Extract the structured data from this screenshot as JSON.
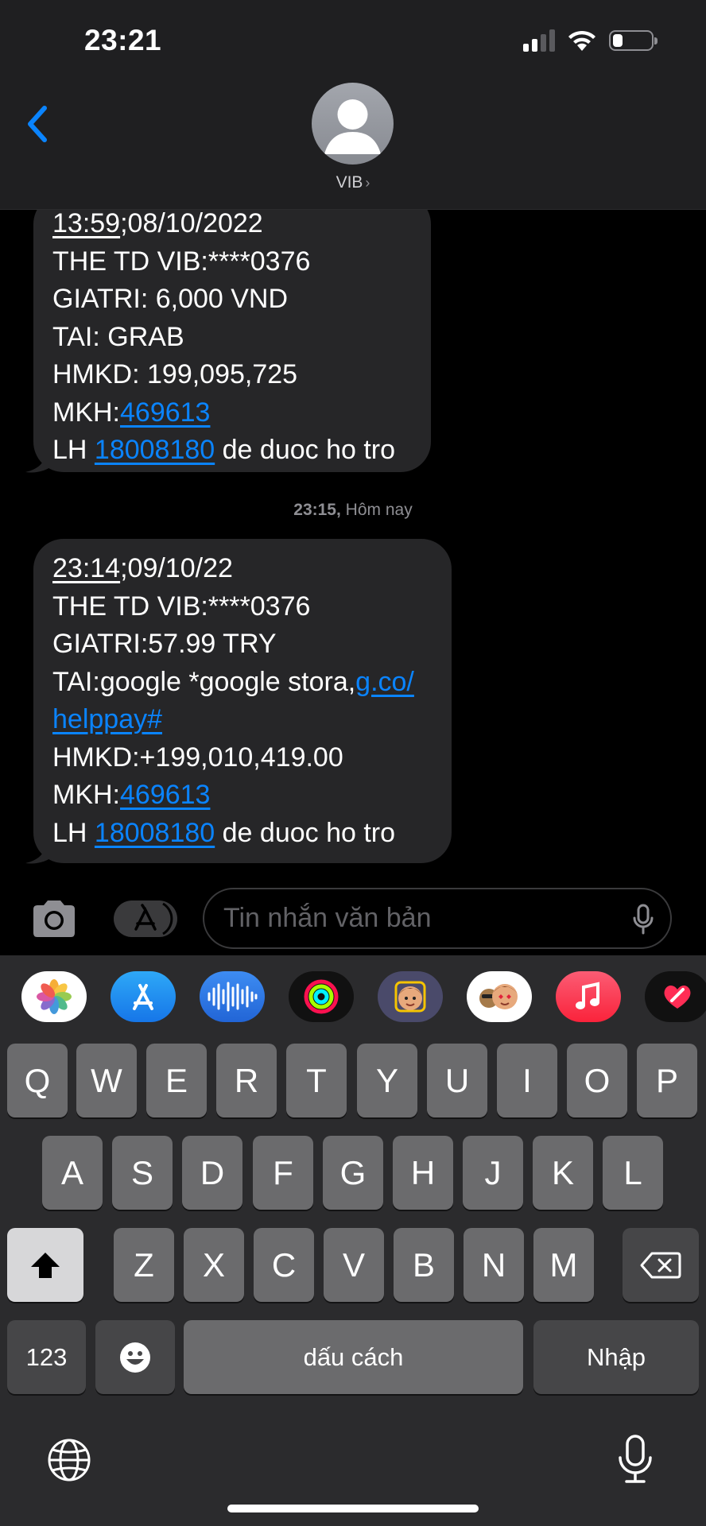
{
  "status_bar": {
    "time": "23:21",
    "battery_level": 0.25
  },
  "header": {
    "contact_name": "VIB",
    "contact_chevron": "›"
  },
  "messages": [
    {
      "lines": [
        "13:59;08/10/2022",
        "THE TD VIB:****0376",
        "GIATRI: 6,000 VND",
        "TAI: GRAB",
        "HMKD: 199,095,725",
        "MKH:469613",
        "LH 18008180 de duoc ho tro"
      ],
      "time_prefix": "13:59",
      "time_suffix": ";08/10/2022",
      "mkh_label": "MKH:",
      "mkh_value": "469613",
      "lh_label": "LH ",
      "phone": "18008180",
      "lh_suffix": " de duoc ho tro"
    },
    {
      "timestamp_time": "23:15,",
      "timestamp_day": "Hôm nay",
      "time_prefix": "23:14",
      "time_suffix": ";09/10/22",
      "card_line": "THE TD VIB:****0376",
      "amount_line": "GIATRI:57.99 TRY",
      "merchant_prefix": "TAI:google *google stora,",
      "merchant_link_a": "g.co/",
      "merchant_link_b": "helppay#",
      "balance_line": "HMKD:+199,010,419.00",
      "mkh_label": "MKH:",
      "mkh_value": "469613",
      "lh_label": "LH ",
      "phone": "18008180",
      "lh_suffix": " de duoc ho tro"
    }
  ],
  "composer": {
    "placeholder": "Tin nhắn văn bản"
  },
  "app_strip": [
    "photos-icon",
    "app-store-icon",
    "audio-message-icon",
    "activity-icon",
    "memoji-icon",
    "memoji-stickers-icon",
    "music-icon",
    "digital-touch-icon"
  ],
  "keyboard": {
    "row1": [
      "Q",
      "W",
      "E",
      "R",
      "T",
      "Y",
      "U",
      "I",
      "O",
      "P"
    ],
    "row2": [
      "A",
      "S",
      "D",
      "F",
      "G",
      "H",
      "J",
      "K",
      "L"
    ],
    "row3": [
      "Z",
      "X",
      "C",
      "V",
      "B",
      "N",
      "M"
    ],
    "numbers_label": "123",
    "space_label": "dấu cách",
    "return_label": "Nhập"
  },
  "colors": {
    "accent": "#0a84ff",
    "bubble": "#262628",
    "key": "#6b6b6d",
    "key_dark": "#464648"
  }
}
